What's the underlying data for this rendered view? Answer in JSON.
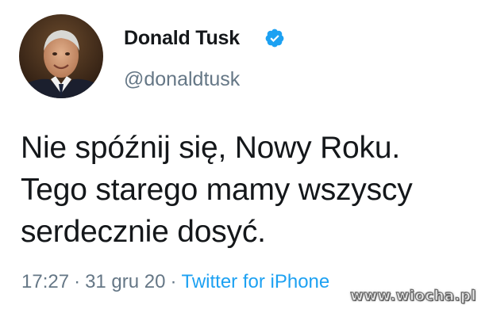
{
  "author": {
    "name": "Donald Tusk",
    "handle": "@donaldtusk",
    "verified": true,
    "verified_icon": "verified-badge-icon",
    "avatar_icon": "profile-photo"
  },
  "tweet": {
    "text_lines": [
      "Nie spóźnij się, Nowy Roku.",
      "Tego starego mamy wszyscy",
      "serdecznie dosyć."
    ],
    "time": "17:27",
    "separator": "·",
    "date": "31 gru 20",
    "source": "Twitter for iPhone"
  },
  "watermark": "www.wiocha.pl",
  "colors": {
    "text": "#14171a",
    "secondary": "#657786",
    "accent": "#1da1f2",
    "background": "#ffffff"
  }
}
